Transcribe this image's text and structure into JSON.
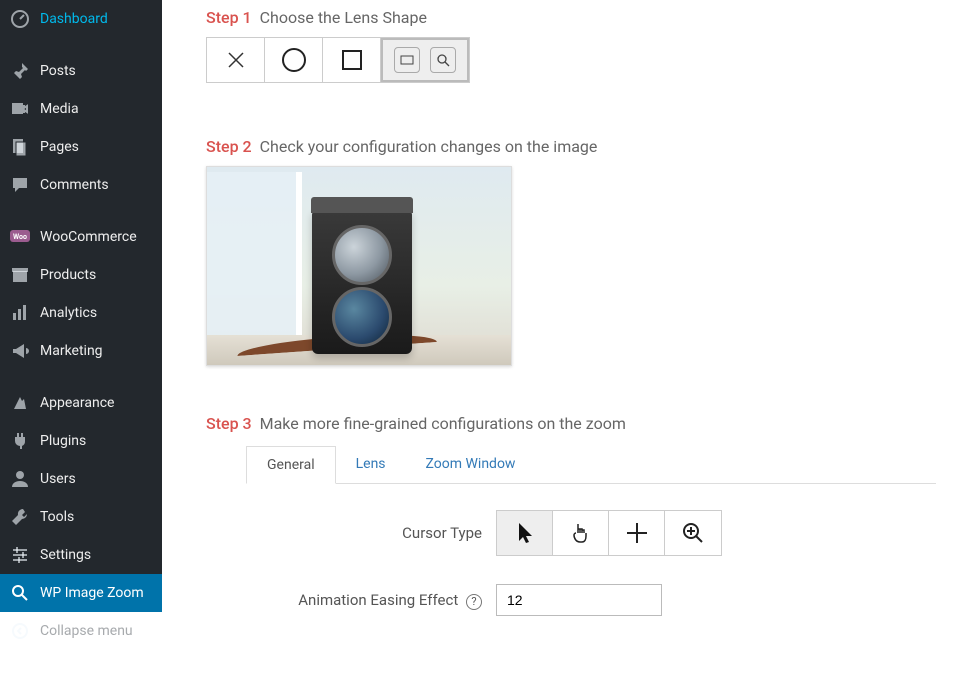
{
  "sidebar": {
    "items": [
      {
        "label": "Dashboard"
      },
      {
        "label": "Posts"
      },
      {
        "label": "Media"
      },
      {
        "label": "Pages"
      },
      {
        "label": "Comments"
      },
      {
        "label": "WooCommerce"
      },
      {
        "label": "Products"
      },
      {
        "label": "Analytics"
      },
      {
        "label": "Marketing"
      },
      {
        "label": "Appearance"
      },
      {
        "label": "Plugins"
      },
      {
        "label": "Users"
      },
      {
        "label": "Tools"
      },
      {
        "label": "Settings"
      },
      {
        "label": "WP Image Zoom"
      },
      {
        "label": "Collapse menu"
      }
    ]
  },
  "step1": {
    "label": "Step 1",
    "desc": "Choose the Lens Shape"
  },
  "step2": {
    "label": "Step 2",
    "desc": "Check your configuration changes on the image"
  },
  "step3": {
    "label": "Step 3",
    "desc": "Make more fine-grained configurations on the zoom"
  },
  "tabs": {
    "general": "General",
    "lens": "Lens",
    "zoom_window": "Zoom Window"
  },
  "form": {
    "cursor_type_label": "Cursor Type",
    "animation_easing_label": "Animation Easing Effect",
    "animation_easing_value": "12"
  }
}
